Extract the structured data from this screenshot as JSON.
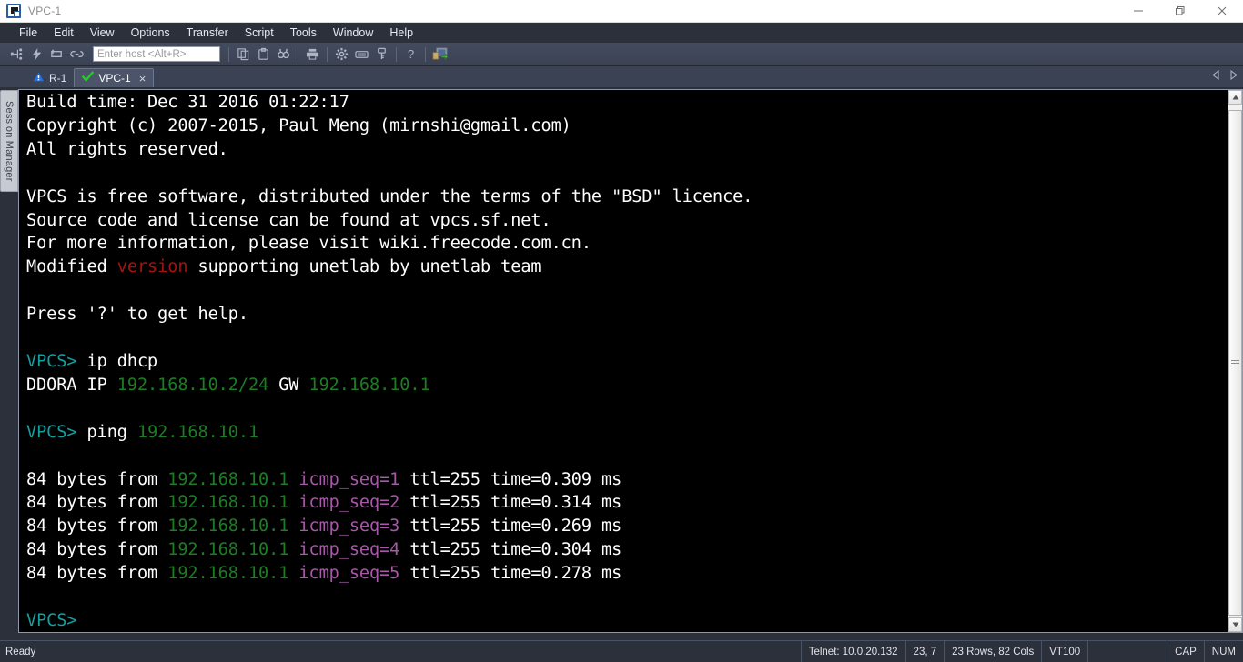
{
  "window": {
    "title": "VPC-1",
    "icon": "terminal-window-icon",
    "minimize_label": "Minimize",
    "restore_label": "Restore",
    "close_label": "Close"
  },
  "menubar": {
    "items": [
      {
        "label": "File",
        "name": "menu-file"
      },
      {
        "label": "Edit",
        "name": "menu-edit"
      },
      {
        "label": "View",
        "name": "menu-view"
      },
      {
        "label": "Options",
        "name": "menu-options"
      },
      {
        "label": "Transfer",
        "name": "menu-transfer"
      },
      {
        "label": "Script",
        "name": "menu-script"
      },
      {
        "label": "Tools",
        "name": "menu-tools"
      },
      {
        "label": "Window",
        "name": "menu-window"
      },
      {
        "label": "Help",
        "name": "menu-help"
      }
    ]
  },
  "toolbar": {
    "host_input_placeholder": "Enter host <Alt+R>",
    "host_input_value": "",
    "icons": [
      "connect-icon",
      "quick-connect-icon",
      "reconnect-icon",
      "disconnect-icon",
      "copy-icon",
      "paste-icon",
      "find-icon",
      "print-icon",
      "settings-gear-icon",
      "keyboard-icon",
      "key-icon",
      "help-question-icon",
      "session-manager-icon"
    ]
  },
  "tabbar": {
    "tabs": [
      {
        "label": "R-1",
        "name": "tab-r-1",
        "status_icon": "warning-triangle-icon",
        "active": false,
        "closable": false
      },
      {
        "label": "VPC-1",
        "name": "tab-vpc-1",
        "status_icon": "green-check-icon",
        "active": true,
        "closable": true
      }
    ],
    "close_glyph": "×",
    "scroll_left": "scroll-left-arrow-icon",
    "scroll_right": "scroll-right-arrow-icon"
  },
  "sidebar": {
    "label": "Session Manager"
  },
  "terminal": {
    "lines": [
      [
        {
          "t": "Build time: Dec 31 2016 01:22:17",
          "c": "white"
        }
      ],
      [
        {
          "t": "Copyright (c) 2007-2015, Paul Meng (mirnshi@gmail.com)",
          "c": "white"
        }
      ],
      [
        {
          "t": "All rights reserved.",
          "c": "white"
        }
      ],
      [
        {
          "t": "",
          "c": "white"
        }
      ],
      [
        {
          "t": "VPCS is free software, distributed under the terms of the \"BSD\" licence.",
          "c": "white"
        }
      ],
      [
        {
          "t": "Source code and license can be found at vpcs.sf.net.",
          "c": "white"
        }
      ],
      [
        {
          "t": "For more information, please visit wiki.freecode.com.cn.",
          "c": "white"
        }
      ],
      [
        {
          "t": "Modified ",
          "c": "white"
        },
        {
          "t": "version",
          "c": "red"
        },
        {
          "t": " supporting unetlab by unetlab team",
          "c": "white"
        }
      ],
      [
        {
          "t": "",
          "c": "white"
        }
      ],
      [
        {
          "t": "Press '?' to get help.",
          "c": "white"
        }
      ],
      [
        {
          "t": "",
          "c": "white"
        }
      ],
      [
        {
          "t": "VPCS> ",
          "c": "prompt"
        },
        {
          "t": "ip dhcp",
          "c": "white"
        }
      ],
      [
        {
          "t": "DDORA IP ",
          "c": "white"
        },
        {
          "t": "192.168.10.2/24",
          "c": "green"
        },
        {
          "t": " GW ",
          "c": "white"
        },
        {
          "t": "192.168.10.1",
          "c": "green"
        }
      ],
      [
        {
          "t": "",
          "c": "white"
        }
      ],
      [
        {
          "t": "VPCS> ",
          "c": "prompt"
        },
        {
          "t": "ping ",
          "c": "white"
        },
        {
          "t": "192.168.10.1",
          "c": "green"
        }
      ],
      [
        {
          "t": "",
          "c": "white"
        }
      ],
      [
        {
          "t": "84 bytes from ",
          "c": "white"
        },
        {
          "t": "192.168.10.1",
          "c": "green"
        },
        {
          "t": " ",
          "c": "white"
        },
        {
          "t": "icmp_seq=1",
          "c": "magenta"
        },
        {
          "t": " ttl=255 time=0.309 ms",
          "c": "white"
        }
      ],
      [
        {
          "t": "84 bytes from ",
          "c": "white"
        },
        {
          "t": "192.168.10.1",
          "c": "green"
        },
        {
          "t": " ",
          "c": "white"
        },
        {
          "t": "icmp_seq=2",
          "c": "magenta"
        },
        {
          "t": " ttl=255 time=0.314 ms",
          "c": "white"
        }
      ],
      [
        {
          "t": "84 bytes from ",
          "c": "white"
        },
        {
          "t": "192.168.10.1",
          "c": "green"
        },
        {
          "t": " ",
          "c": "white"
        },
        {
          "t": "icmp_seq=3",
          "c": "magenta"
        },
        {
          "t": " ttl=255 time=0.269 ms",
          "c": "white"
        }
      ],
      [
        {
          "t": "84 bytes from ",
          "c": "white"
        },
        {
          "t": "192.168.10.1",
          "c": "green"
        },
        {
          "t": " ",
          "c": "white"
        },
        {
          "t": "icmp_seq=4",
          "c": "magenta"
        },
        {
          "t": " ttl=255 time=0.304 ms",
          "c": "white"
        }
      ],
      [
        {
          "t": "84 bytes from ",
          "c": "white"
        },
        {
          "t": "192.168.10.1",
          "c": "green"
        },
        {
          "t": " ",
          "c": "white"
        },
        {
          "t": "icmp_seq=5",
          "c": "magenta"
        },
        {
          "t": " ttl=255 time=0.278 ms",
          "c": "white"
        }
      ],
      [
        {
          "t": "",
          "c": "white"
        }
      ],
      [
        {
          "t": "VPCS>",
          "c": "prompt"
        }
      ]
    ],
    "colors": {
      "background": "#000000",
      "foreground": "#ffffff",
      "prompt": "#12a0a0",
      "green": "#1d7d24",
      "magenta": "#a858a8",
      "red": "#aa1010"
    }
  },
  "statusbar": {
    "ready": "Ready",
    "connection": "Telnet: 10.0.20.132",
    "cursor": "23,  7",
    "dimensions": "23 Rows, 82 Cols",
    "emulation": "VT100",
    "blank": "",
    "caps": "CAP",
    "num": "NUM"
  }
}
